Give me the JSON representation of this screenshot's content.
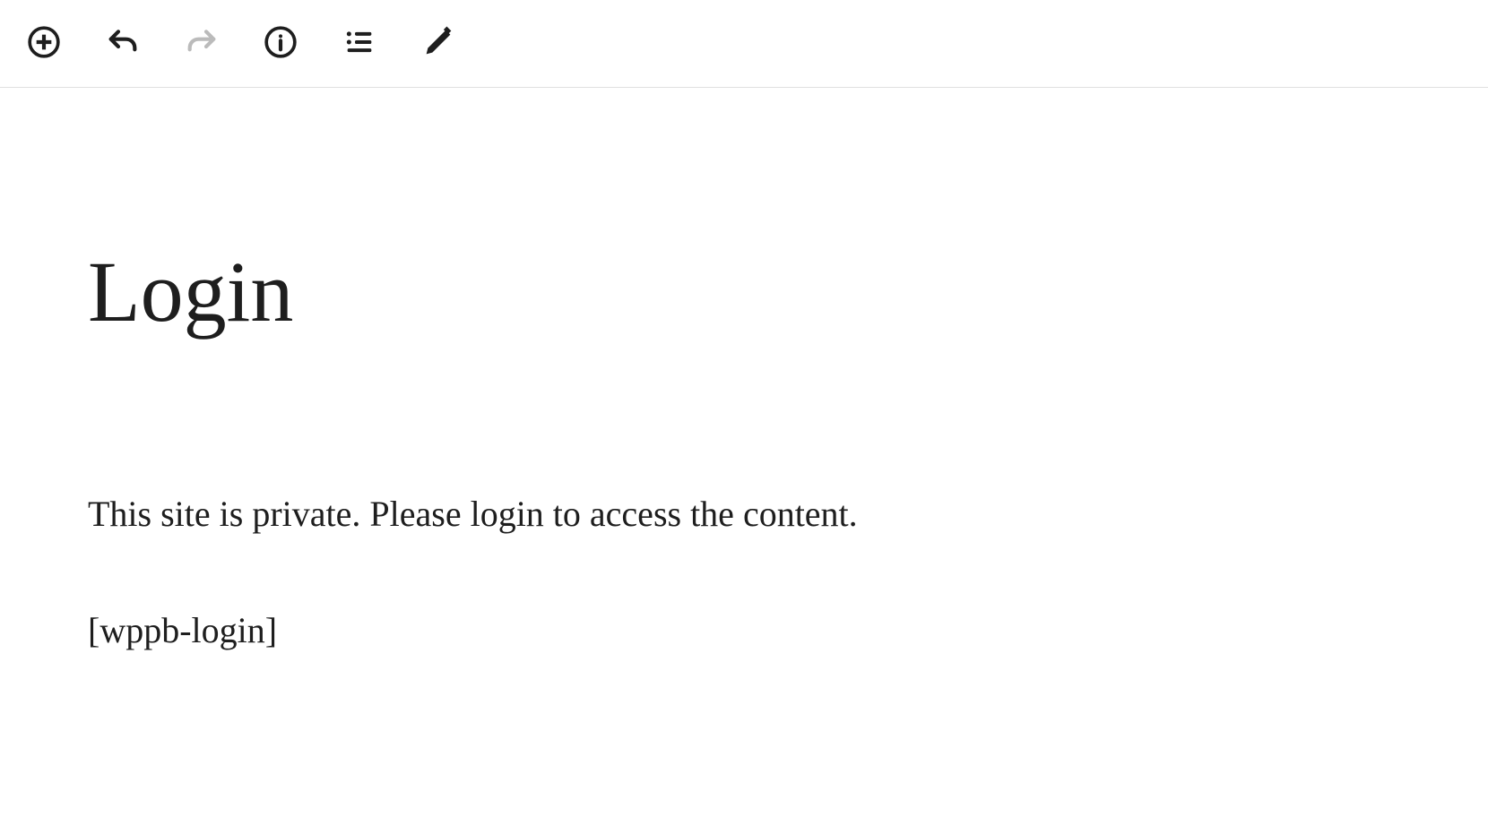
{
  "page": {
    "title": "Login",
    "paragraph": "This site is private. Please login to access the content.",
    "shortcode": "[wppb-login]"
  }
}
